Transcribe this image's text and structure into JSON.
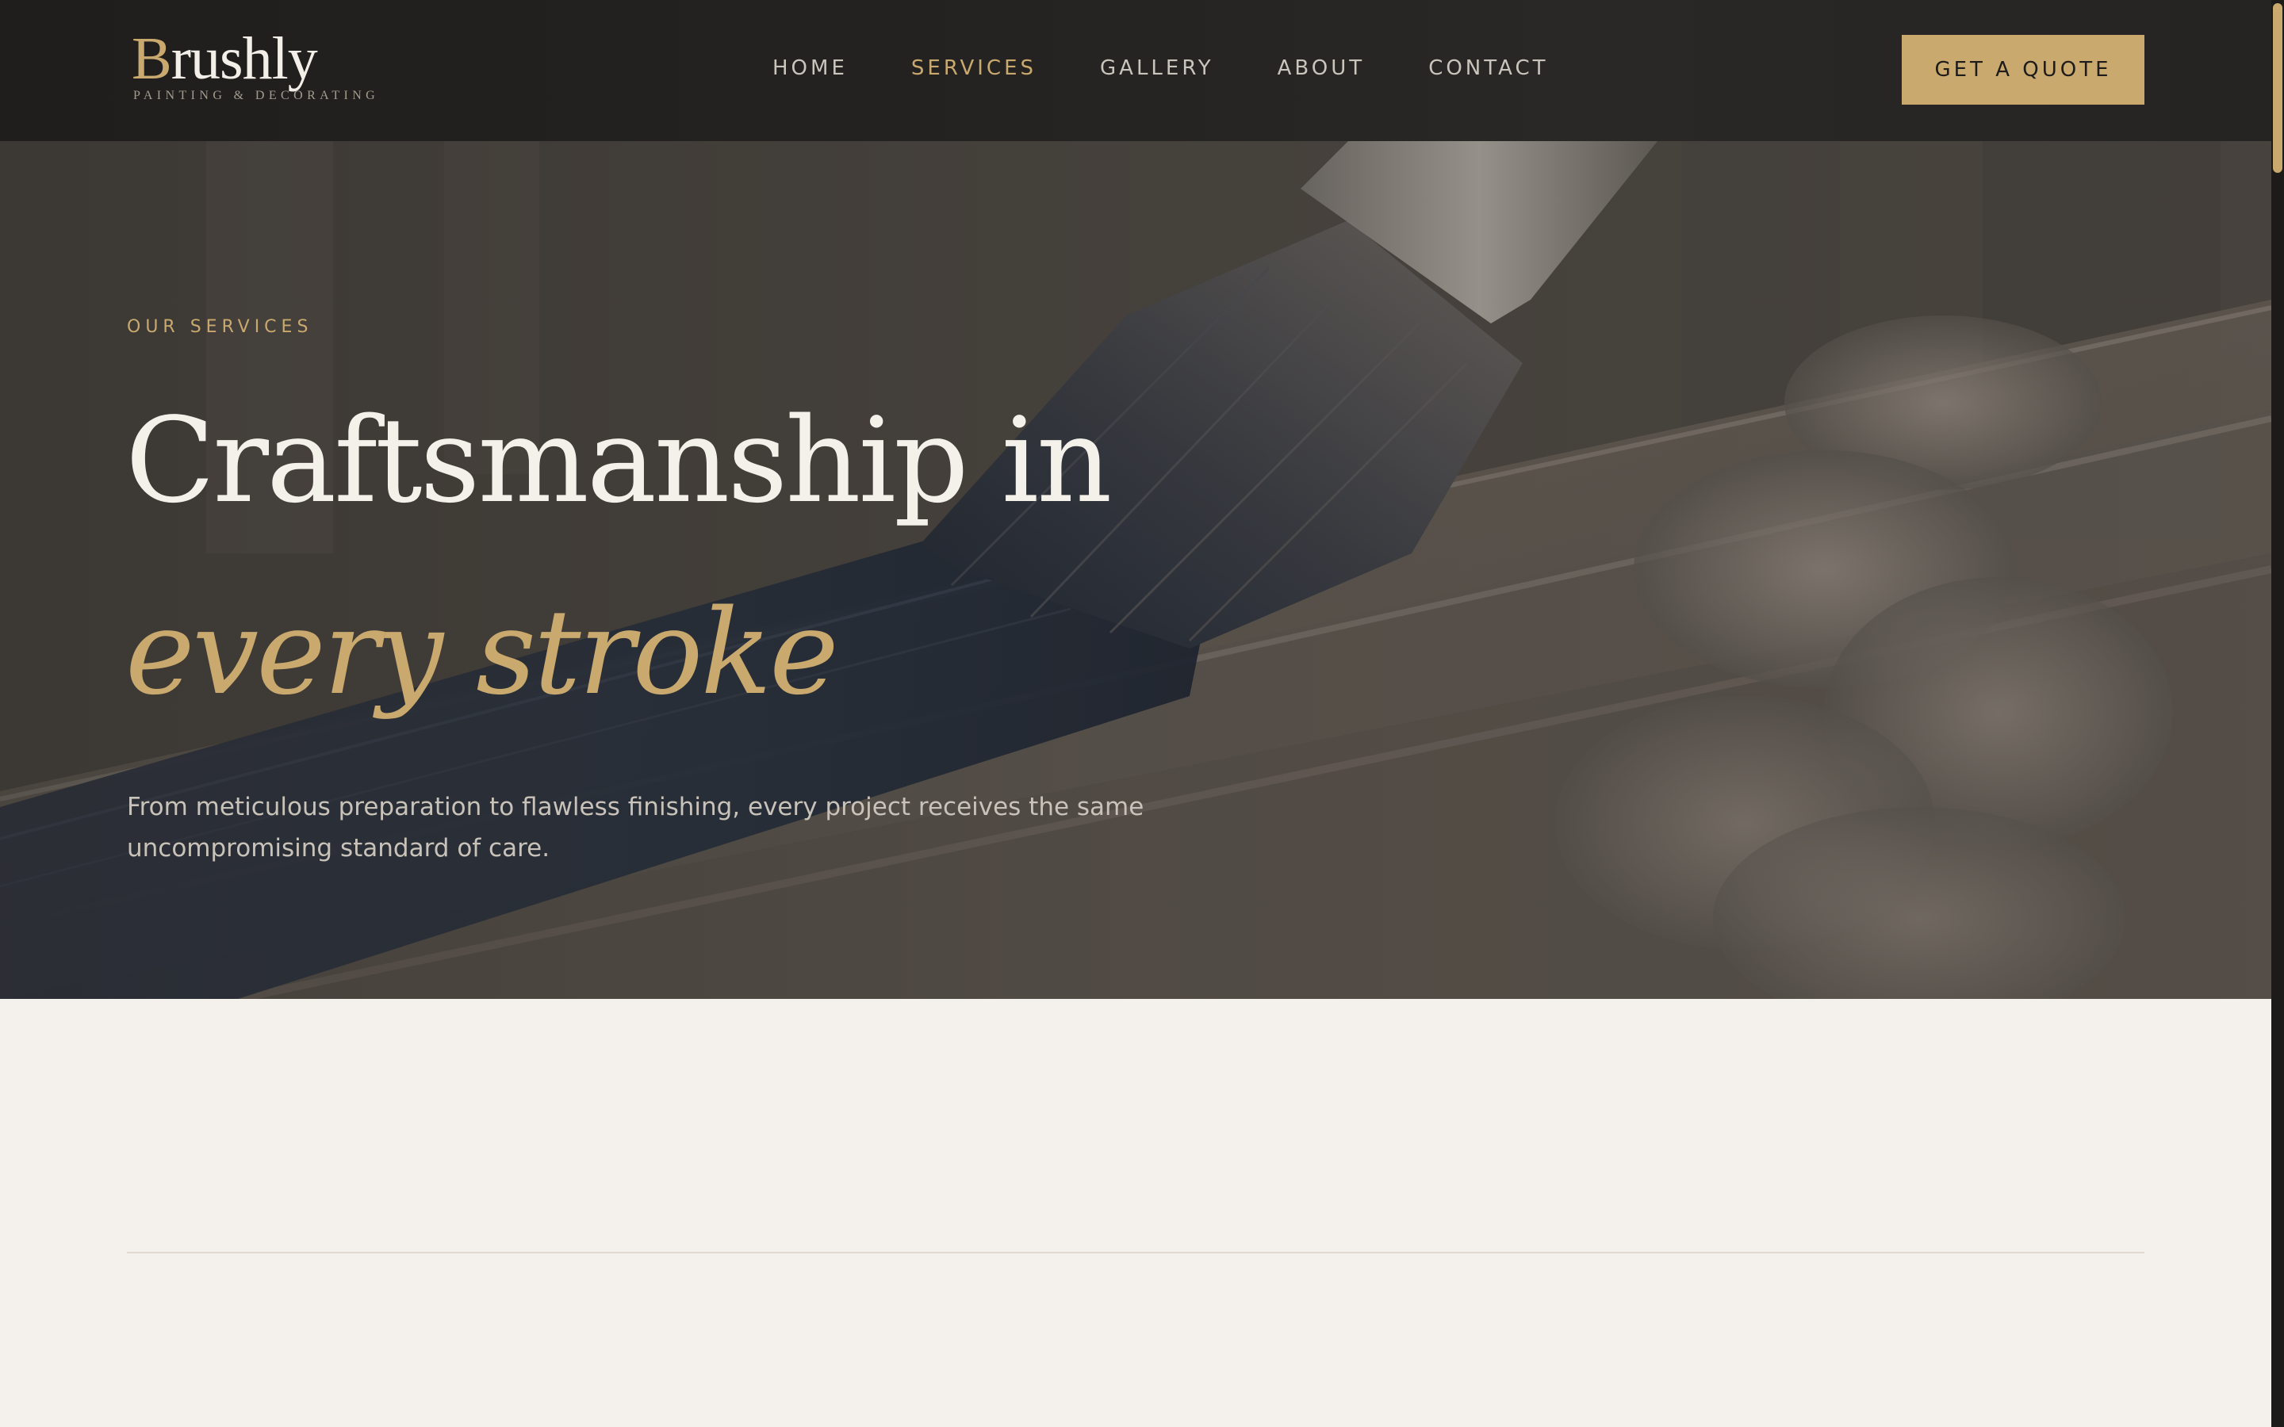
{
  "brand": {
    "initial": "B",
    "rest": "rushly",
    "tagline": "PAINTING & DECORATING"
  },
  "nav": {
    "items": [
      {
        "label": "HOME",
        "active": false
      },
      {
        "label": "SERVICES",
        "active": true
      },
      {
        "label": "GALLERY",
        "active": false
      },
      {
        "label": "ABOUT",
        "active": false
      },
      {
        "label": "CONTACT",
        "active": false
      }
    ],
    "cta_label": "GET A QUOTE"
  },
  "hero": {
    "eyebrow": "OUR SERVICES",
    "title_line1": "Craftsmanship in",
    "title_line2": "every stroke",
    "description": "From meticulous preparation to flawless finishing, every project receives the same uncompromising standard of care.",
    "background_image": "paintbrush applying navy paint on ornate moulding"
  },
  "colors": {
    "accent": "#c9a96e",
    "header_bg": "#232120",
    "page_bg": "#f4f0eb",
    "title_text": "#f4f0ea"
  }
}
